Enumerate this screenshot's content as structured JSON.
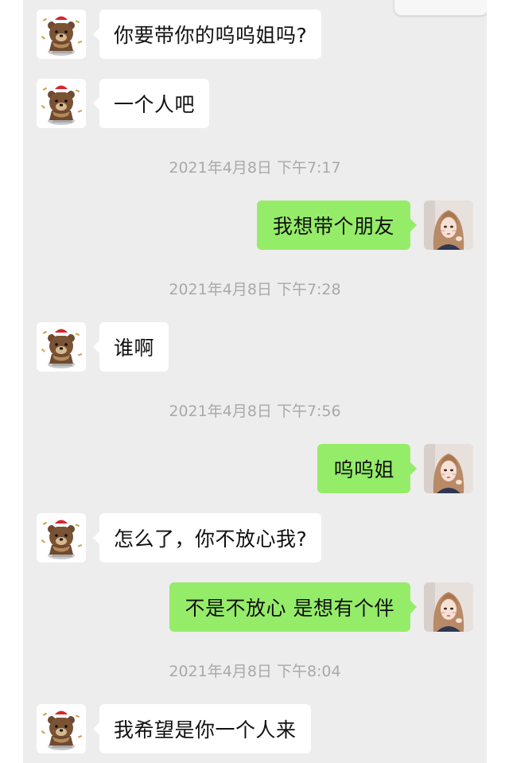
{
  "conversation": {
    "messages": [
      {
        "sender": "other",
        "avatar": "bear-avatar",
        "text": "你要带你的呜呜姐吗?"
      },
      {
        "sender": "other",
        "avatar": "bear-avatar",
        "text": "一个人吧"
      },
      {
        "type": "timestamp",
        "text": "2021年4月8日 下午7:17"
      },
      {
        "sender": "me",
        "avatar": "girl-avatar",
        "text": "我想带个朋友"
      },
      {
        "type": "timestamp",
        "text": "2021年4月8日 下午7:28"
      },
      {
        "sender": "other",
        "avatar": "bear-avatar",
        "text": "谁啊"
      },
      {
        "type": "timestamp",
        "text": "2021年4月8日 下午7:56"
      },
      {
        "sender": "me",
        "avatar": "girl-avatar",
        "text": "呜呜姐"
      },
      {
        "sender": "other",
        "avatar": "bear-avatar",
        "text": "怎么了，你不放心我?"
      },
      {
        "sender": "me",
        "avatar": "girl-avatar",
        "text": "不是不放心 是想有个伴"
      },
      {
        "type": "timestamp",
        "text": "2021年4月8日 下午8:04"
      },
      {
        "sender": "other",
        "avatar": "bear-avatar",
        "text": "我希望是你一个人来"
      }
    ]
  },
  "colors": {
    "chat_background": "#ededed",
    "incoming_bubble": "#ffffff",
    "outgoing_bubble": "#95ec69",
    "timestamp_text": "#a9a9a9"
  }
}
